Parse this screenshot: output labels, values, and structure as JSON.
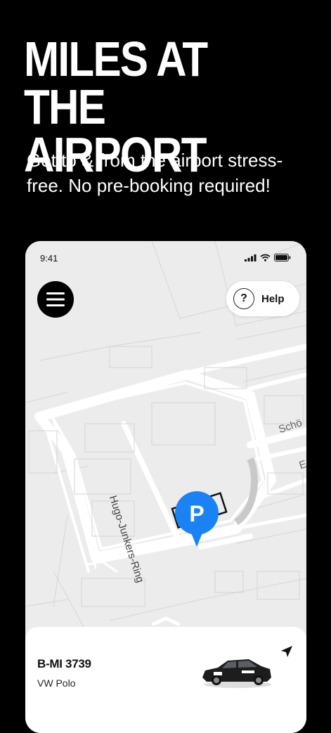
{
  "headline": {
    "line1": "MILES AT THE",
    "line2": "AIRPORT"
  },
  "subtitle": "Get to & from the airport stress-free. No pre-booking required!",
  "phone": {
    "status": {
      "time": "9:41"
    },
    "menu": {
      "icon": "menu-icon"
    },
    "help": {
      "icon": "question-icon",
      "label": "Help"
    },
    "map": {
      "street_1": "Hugo-Junkers-Ring",
      "street_2": "Schö",
      "street_3": "E",
      "parking_pin_label": "P",
      "pin_color": "#1a82f5"
    },
    "sheet": {
      "plate": "B-MI 3739",
      "model": "VW Polo",
      "nav_icon": "navigation-arrow-icon",
      "expand_icon": "chevron-up-icon"
    }
  }
}
